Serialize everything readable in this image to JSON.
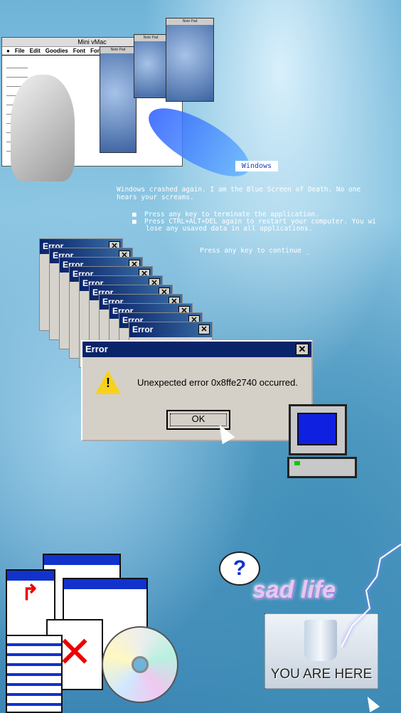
{
  "mac_window": {
    "title": "Mini vMac",
    "menu": [
      "File",
      "Edit",
      "Goodies",
      "Font",
      "FontSiz"
    ]
  },
  "notepads": [
    "Note Pad",
    "Note Pad",
    "Note Pad"
  ],
  "bsod": {
    "title": "Windows",
    "line1": "Windows crashed again. I am the Blue Screen of Death. No one",
    "line2": "hears your screams.",
    "bullet1": "Press any key to terminate the application.",
    "bullet2": "Press CTRL+ALT+DEL again to restart your computer. You wi",
    "bullet2b": "lose any usaved data in all applications.",
    "continue": "Press any key to continue _"
  },
  "cascade_title": "Error",
  "dialog": {
    "title": "Error",
    "message": "Unexpected error 0x8ffe2740 occurred.",
    "ok_label": "OK",
    "icon": "warning-icon"
  },
  "bubble": "?",
  "sad_text": "sad life",
  "recycle_bin": {
    "caption": "YOU ARE HERE"
  }
}
